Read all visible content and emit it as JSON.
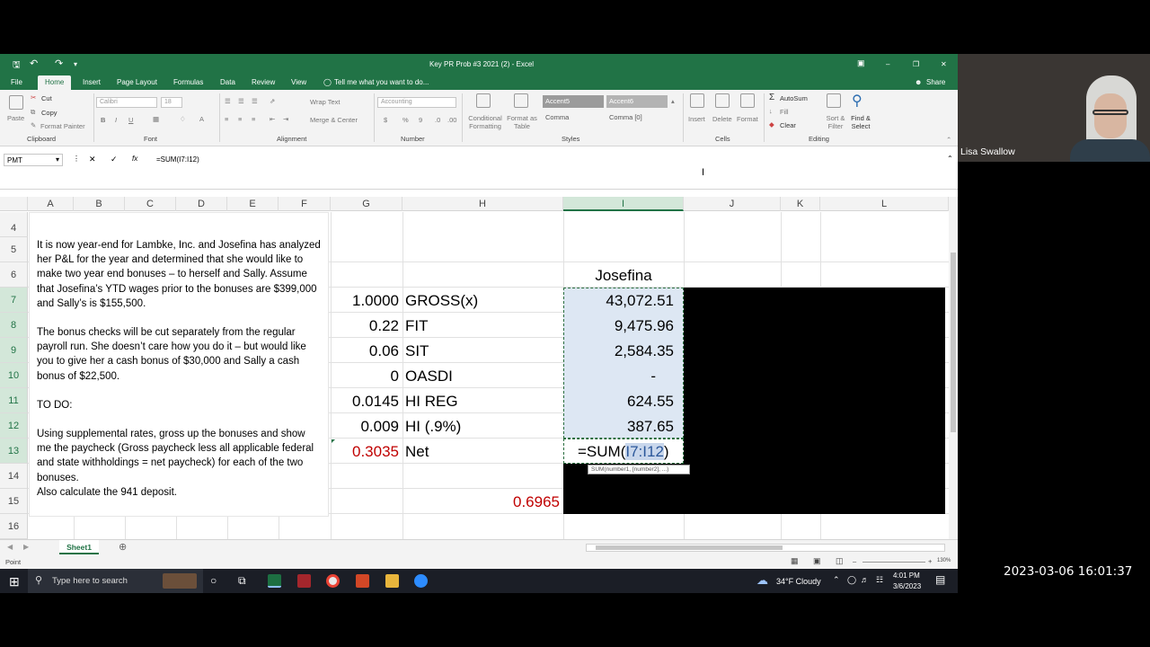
{
  "window": {
    "title": "Key PR Prob #3 2021 (2) - Excel",
    "minimize": "–",
    "restore": "❐",
    "close": "✕"
  },
  "quick_access": {
    "undo": "↶",
    "redo": "↷",
    "dropdown": "▾"
  },
  "ribbon_tabs": [
    "File",
    "Home",
    "Insert",
    "Page Layout",
    "Formulas",
    "Data",
    "Review",
    "View"
  ],
  "tell_me": "Tell me what you want to do...",
  "share": "Share",
  "ribbon": {
    "clipboard": {
      "paste": "Paste",
      "cut": "Cut",
      "copy": "Copy",
      "format_painter": "Format Painter",
      "label": "Clipboard"
    },
    "font": {
      "name": "Calibri",
      "size": "18",
      "bold": "B",
      "italic": "I",
      "underline": "U",
      "label": "Font"
    },
    "alignment": {
      "wrap": "Wrap Text",
      "merge": "Merge & Center",
      "label": "Alignment"
    },
    "number": {
      "format": "Accounting",
      "currency": "$",
      "percent": "%",
      "comma": "9",
      "label": "Number"
    },
    "styles": {
      "conditional": "Conditional Formatting",
      "format_as_table": "Format as Table",
      "accent5": "Accent5",
      "accent6": "Accent6",
      "comma": "Comma",
      "comma0": "Comma [0]",
      "label": "Styles"
    },
    "cells": {
      "insert": "Insert",
      "delete": "Delete",
      "format": "Format",
      "label": "Cells"
    },
    "editing": {
      "autosum": "AutoSum",
      "fill": "Fill",
      "clear": "Clear",
      "sort": "Sort & Filter",
      "find": "Find & Select",
      "label": "Editing"
    }
  },
  "formula_bar": {
    "name_box": "PMT",
    "cancel": "✕",
    "enter": "✓",
    "fx": "fx",
    "formula": "=SUM(I7:I12)"
  },
  "columns": [
    "A",
    "B",
    "C",
    "D",
    "E",
    "F",
    "G",
    "H",
    "I",
    "J",
    "K",
    "L"
  ],
  "rows": [
    "4",
    "5",
    "6",
    "7",
    "8",
    "9",
    "10",
    "11",
    "12",
    "13",
    "14",
    "15",
    "16"
  ],
  "textbox": {
    "p1": "It is now year-end for Lambke, Inc. and Josefina has analyzed her P&L for the year and determined that she would like to make two year end bonuses – to herself and Sally.  Assume that Josefina’s YTD wages prior to the bonuses are $399,000 and Sally’s is $155,500.",
    "p2": "The bonus checks will be cut separately from the regular payroll run.  She doesn’t care how you do it – but would like you to give her a cash bonus of $30,000 and Sally a cash bonus of $22,500.",
    "p3": "TO DO:",
    "p4": "Using supplemental rates, gross up the bonuses and show me the paycheck (Gross paycheck less all applicable federal and state withholdings = net paycheck) for each of the two bonuses.",
    "p5": "Also calculate the 941 deposit."
  },
  "sheet": {
    "header_I6": "Josefina",
    "rows": [
      {
        "g": "1.0000",
        "h": "GROSS(x)",
        "i": "43,072.51"
      },
      {
        "g": "0.22",
        "h": "FIT",
        "i": "9,475.96"
      },
      {
        "g": "0.06",
        "h": "SIT",
        "i": "2,584.35"
      },
      {
        "g": "0",
        "h": "OASDI",
        "i": "-"
      },
      {
        "g": "0.0145",
        "h": "HI REG",
        "i": "624.55"
      },
      {
        "g": "0.009",
        "h": "HI (.9%)",
        "i": "387.65"
      }
    ],
    "net_g": "0.3035",
    "net_h": "Net",
    "edit_prefix": "=SUM(",
    "edit_ref": "I7:I12",
    "edit_suffix": ")",
    "h15": "0.6965",
    "tooltip": "SUM(number1, [number2], ...)",
    "colors": {
      "red": "#c00000",
      "green": "#217346"
    }
  },
  "sheet_tab": "Sheet1",
  "status": {
    "mode": "Point",
    "zoom": "130%"
  },
  "taskbar": {
    "search": "Type here to search",
    "weather": "34°F  Cloudy",
    "time": "4:01 PM",
    "date": "3/6/2023"
  },
  "video": {
    "name": "Lisa Swallow"
  },
  "timestamp": "2023-03-06 16:01:37"
}
